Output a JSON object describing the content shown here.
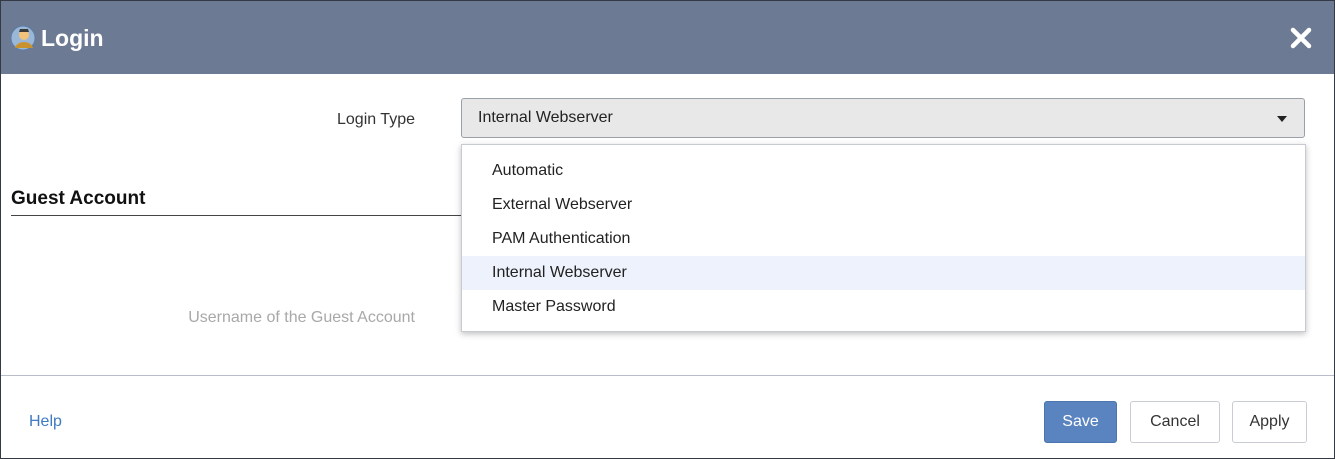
{
  "dialog": {
    "title": "Login",
    "icon": "login-user-icon",
    "close_icon": "close-icon"
  },
  "form": {
    "login_type": {
      "label": "Login Type",
      "value": "Internal Webserver",
      "options": [
        "Automatic",
        "External Webserver",
        "PAM Authentication",
        "Internal Webserver",
        "Master Password"
      ],
      "highlighted_option": "Internal Webserver"
    },
    "guest_section": {
      "heading": "Guest Account",
      "username_label": "Username of the Guest Account"
    }
  },
  "footer": {
    "help": "Help",
    "save": "Save",
    "cancel": "Cancel",
    "apply": "Apply"
  },
  "colors": {
    "titlebar": "#6c7a93",
    "primary_button": "#5a84c0",
    "link": "#3f7ac2",
    "highlight": "#eef2fc"
  }
}
